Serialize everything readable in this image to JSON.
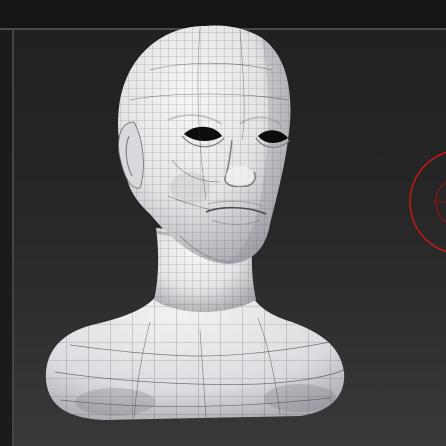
{
  "viewport": {
    "model": "sculpted-head-mesh",
    "wireframe": true,
    "colors": {
      "background_top": "#202020",
      "background_bottom": "#3a3a3a",
      "surface": "#ededef",
      "surface_shade": "#9c9aa0",
      "wire": "#2a2a2a",
      "gizmo": "#c01818"
    }
  }
}
